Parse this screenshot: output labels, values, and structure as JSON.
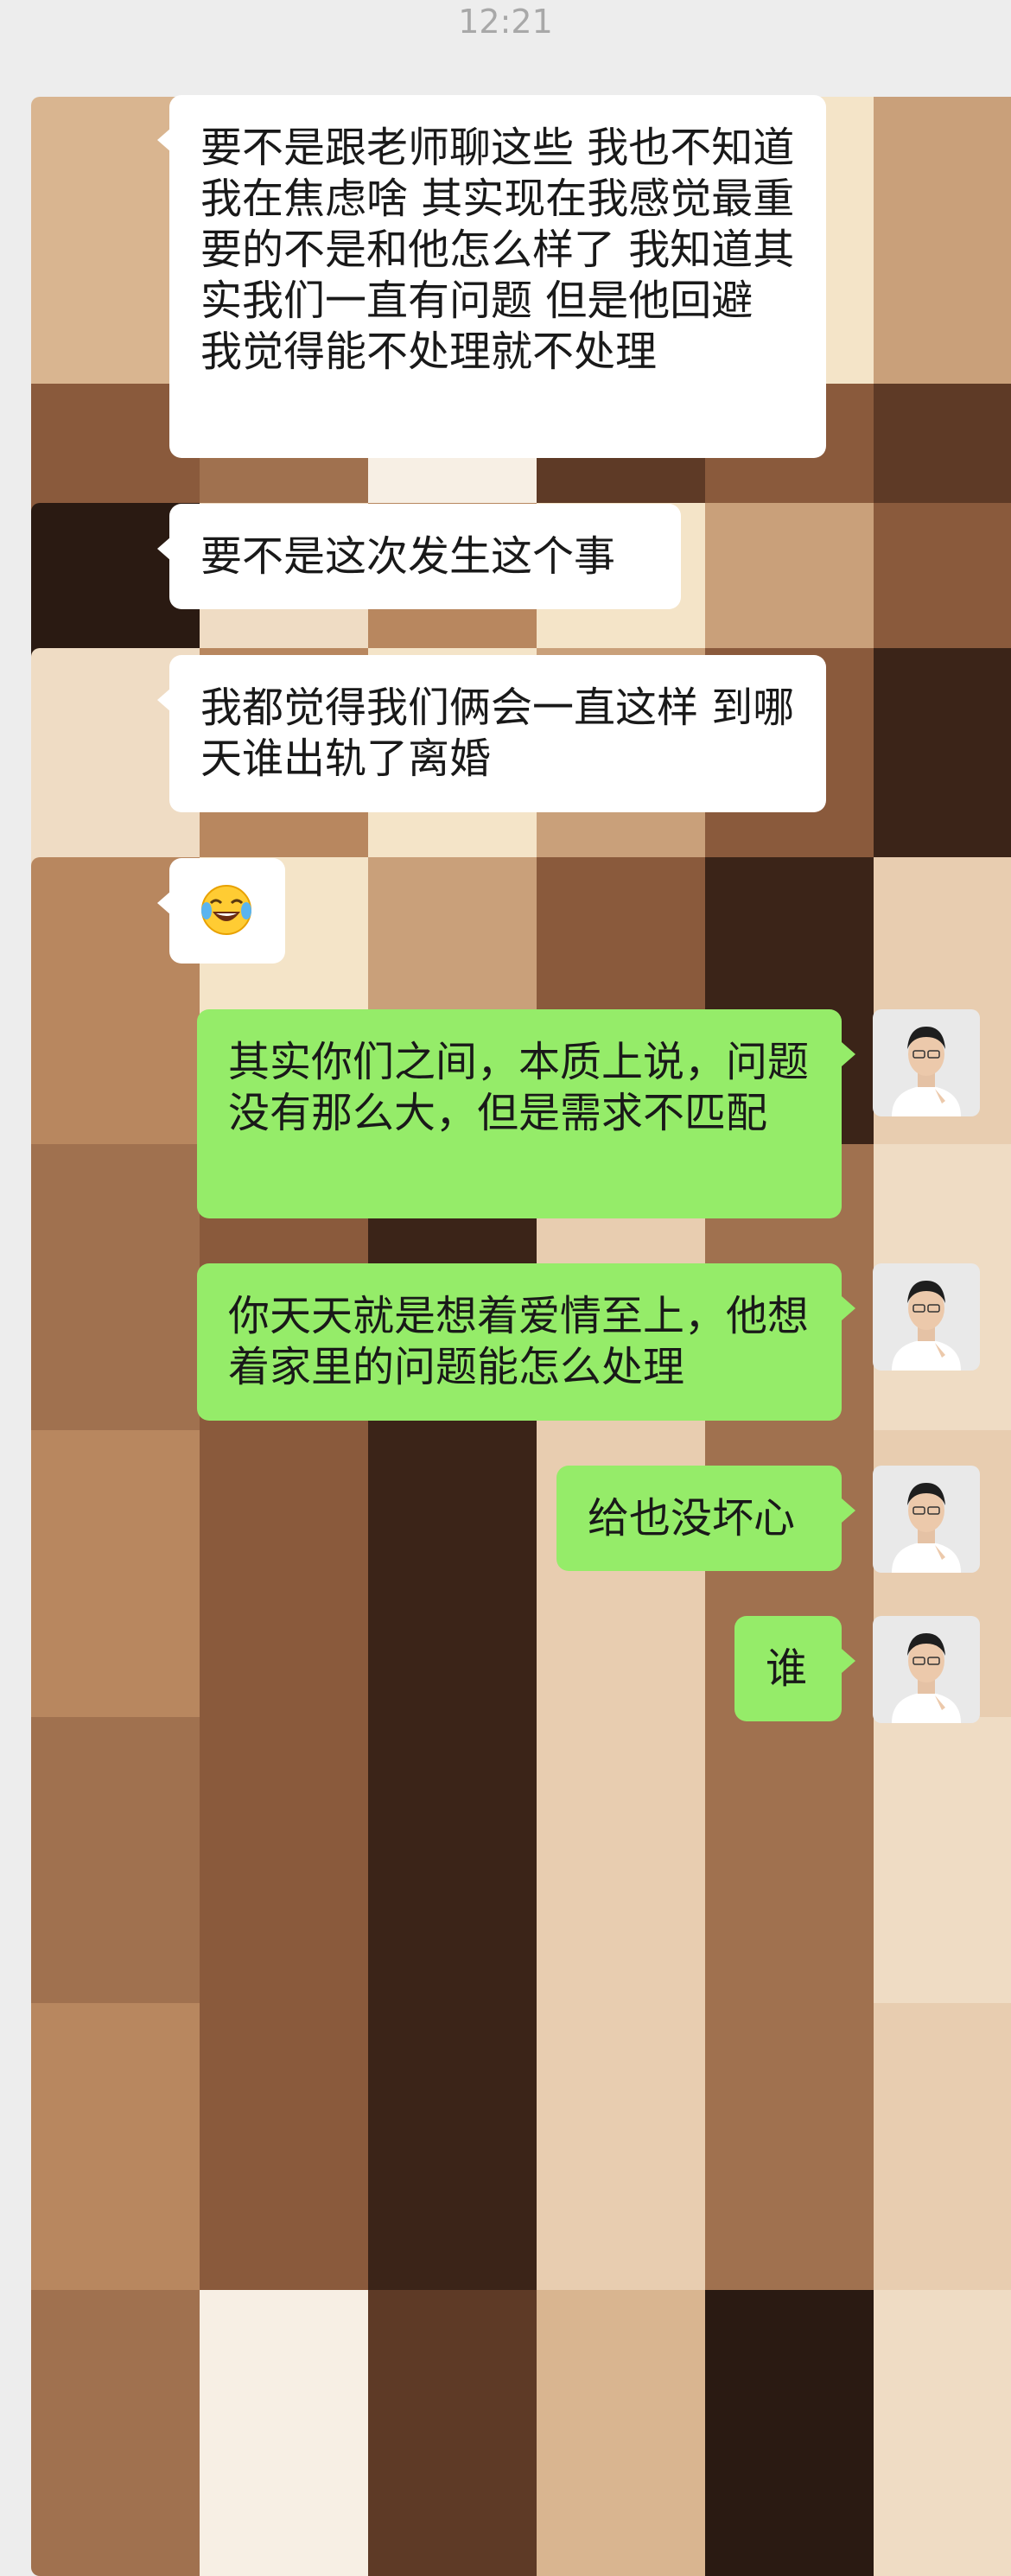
{
  "timestamp": "12:21",
  "messages": [
    {
      "side": "left",
      "text": "要不是跟老师聊这些 我也不知道我在焦虑啥 其实现在我感觉最重要的不是和他怎么样了 我知道其实我们一直有问题 但是他回避 我觉得能不处理就不处理"
    },
    {
      "side": "left",
      "text": "要不是这次发生这个事"
    },
    {
      "side": "left",
      "text": "我都觉得我们俩会一直这样 到哪天谁出轨了离婚"
    },
    {
      "side": "left",
      "emoji": "face-with-tears-of-joy"
    },
    {
      "side": "right",
      "text": "其实你们之间，本质上说，问题没有那么大，但是需求不匹配"
    },
    {
      "side": "right",
      "text": "你天天就是想着爱情至上，他想着家里的问题能怎么处理"
    },
    {
      "side": "right",
      "text": "给也没坏心"
    },
    {
      "side": "right",
      "text": "谁"
    }
  ],
  "colors": {
    "background": "#ededed",
    "incoming_bubble": "#ffffff",
    "outgoing_bubble": "#95ec69",
    "timestamp_text": "#a8a8a8"
  }
}
